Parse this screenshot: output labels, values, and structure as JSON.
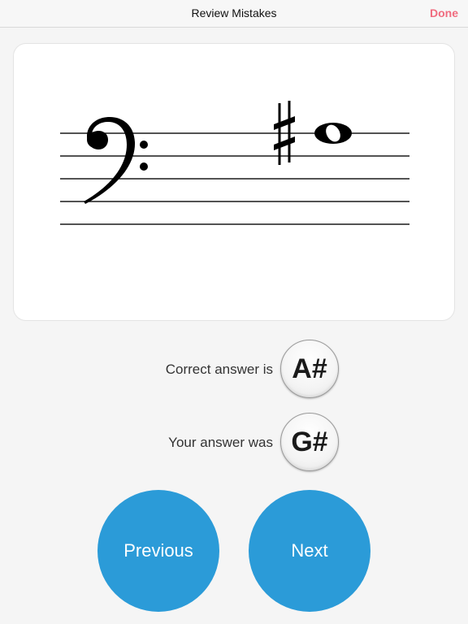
{
  "navbar": {
    "title": "Review Mistakes",
    "done_label": "Done"
  },
  "staff": {
    "clef": "bass-clef",
    "accidental": "sharp",
    "note": "whole-note"
  },
  "answers": {
    "correct_label": "Correct answer is",
    "correct_value": "A#",
    "yours_label": "Your answer was",
    "yours_value": "G#"
  },
  "buttons": {
    "previous_label": "Previous",
    "next_label": "Next"
  },
  "colors": {
    "accent": "#2b9bd8",
    "done": "#f06c7f"
  }
}
